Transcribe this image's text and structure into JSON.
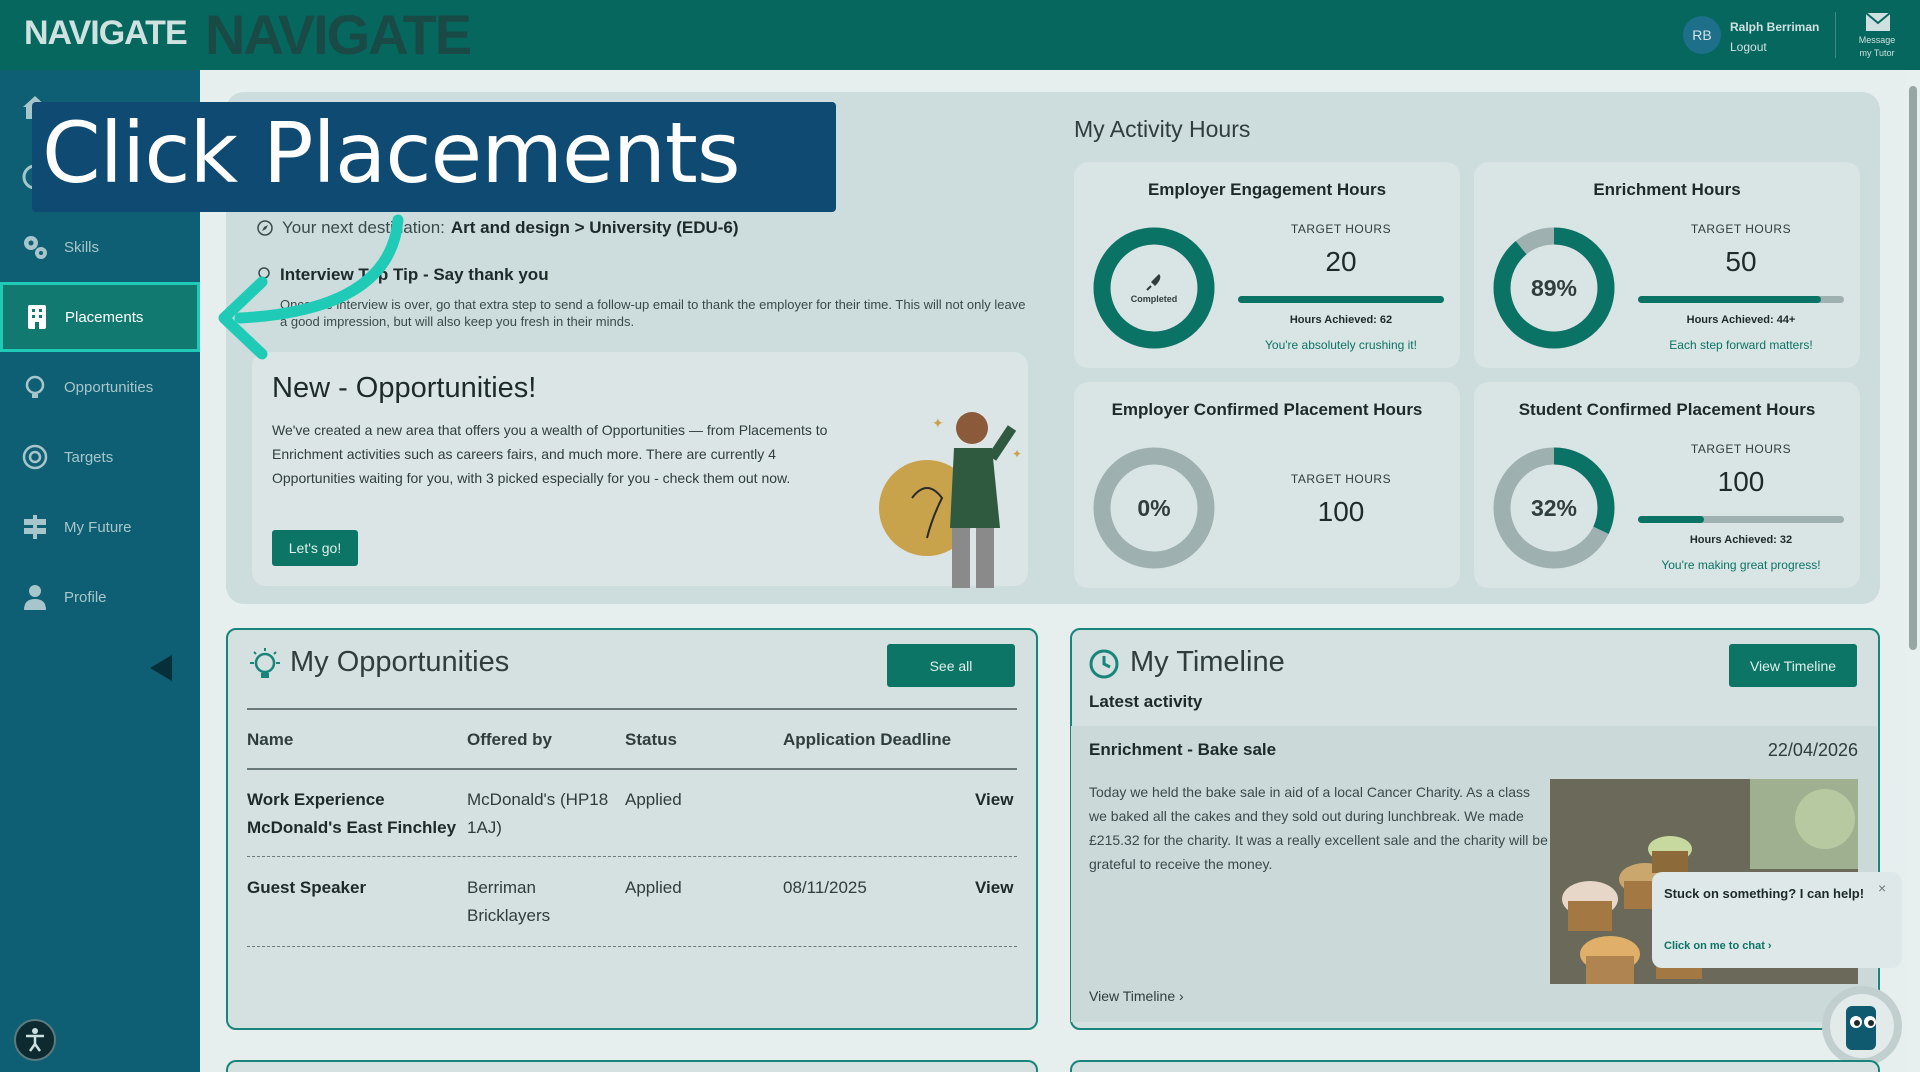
{
  "header": {
    "logo": "NAVIGATE",
    "user_initials": "RB",
    "user_name": "Ralph Berriman",
    "logout": "Logout",
    "message_label_1": "Message",
    "message_label_2": "my Tutor"
  },
  "sidebar": {
    "items": [
      {
        "label": "",
        "icon": "home-icon"
      },
      {
        "label": "",
        "icon": "compass-icon"
      },
      {
        "label": "Skills",
        "icon": "gears-icon"
      },
      {
        "label": "Placements",
        "icon": "building-icon"
      },
      {
        "label": "Opportunities",
        "icon": "lightbulb-icon"
      },
      {
        "label": "Targets",
        "icon": "target-icon"
      },
      {
        "label": "My Future",
        "icon": "signpost-icon"
      },
      {
        "label": "Profile",
        "icon": "user-icon"
      }
    ]
  },
  "callout": {
    "text": "Click Placements"
  },
  "next_destination": {
    "prefix": "Your next destination:",
    "value": "Art and design > University (EDU-6)"
  },
  "tip": {
    "title": "Interview Top Tip - Say thank you",
    "body": "Once the interview is over, go that extra step to send a follow-up email to thank the employer for their time. This will not only leave a good impression, but will also keep you fresh in their minds."
  },
  "opportunities_promo": {
    "title": "New - Opportunities!",
    "body": "We've created a new area that offers you a wealth of Opportunities — from Placements to Enrichment activities such as careers fairs, and much more. There are currently 4 Opportunities waiting for you, with 3 picked especially for you - check them out now.",
    "button": "Let's go!"
  },
  "activity": {
    "title": "My Activity Hours",
    "target_label": "TARGET HOURS",
    "cards": [
      {
        "title": "Employer Engagement Hours",
        "center": "Completed",
        "progress": 1.0,
        "target": "20",
        "achieved": "Hours Achieved: 62",
        "message": "You're absolutely crushing it!",
        "bar": 1.0
      },
      {
        "title": "Enrichment Hours",
        "center": "89%",
        "progress": 0.89,
        "target": "50",
        "achieved": "Hours Achieved: 44+",
        "message": "Each step forward matters!",
        "bar": 0.89
      },
      {
        "title": "Employer Confirmed Placement Hours",
        "center": "0%",
        "progress": 0.0,
        "target": "100",
        "achieved": "",
        "message": "",
        "bar": null
      },
      {
        "title": "Student Confirmed Placement Hours",
        "center": "32%",
        "progress": 0.32,
        "target": "100",
        "achieved": "Hours Achieved: 32",
        "message": "You're making great progress!",
        "bar": 0.32
      }
    ]
  },
  "my_opportunities": {
    "title": "My Opportunities",
    "see_all": "See all",
    "columns": [
      "Name",
      "Offered by",
      "Status",
      "Application Deadline"
    ],
    "rows": [
      {
        "name_1": "Work Experience",
        "name_2": "McDonald's East Finchley",
        "offered_1": "McDonald's (HP18",
        "offered_2": "1AJ)",
        "status": "Applied",
        "deadline": "",
        "action": "View"
      },
      {
        "name_1": "Guest Speaker",
        "name_2": "",
        "offered_1": "Berriman",
        "offered_2": "Bricklayers",
        "status": "Applied",
        "deadline": "08/11/2025",
        "action": "View"
      }
    ]
  },
  "timeline": {
    "title": "My Timeline",
    "button": "View Timeline",
    "latest": "Latest activity",
    "item_name": "Enrichment - Bake sale",
    "item_date": "22/04/2026",
    "item_desc": "Today we held the bake sale in aid of a local Cancer Charity. As a class we baked all the cakes and they sold out during lunchbreak. We made £215.32 for the charity. It was a really excellent sale and the charity will be grateful to receive the money.",
    "link": "View Timeline"
  },
  "chat": {
    "prompt": "Stuck on something? I can help!",
    "link": "Click on me to chat",
    "close": "×"
  },
  "colors": {
    "teal": "#0b7366",
    "highlight": "#1fcbb6",
    "callout": "#0e4a72"
  }
}
